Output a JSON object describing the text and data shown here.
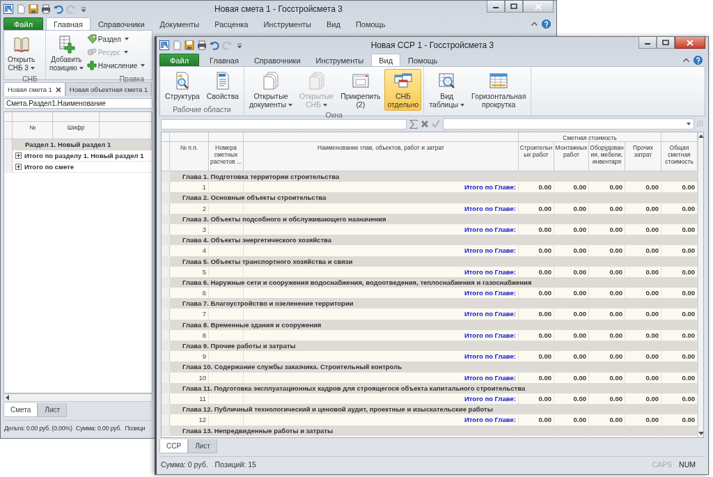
{
  "back_window": {
    "title": "Новая смета 1 - Госстройсмета 3",
    "ribbon_tabs": [
      {
        "label": "Файл",
        "kind": "file",
        "selected": false
      },
      {
        "label": "Главная",
        "kind": "tab",
        "selected": true
      },
      {
        "label": "Справочники",
        "kind": "tab",
        "selected": false
      },
      {
        "label": "Документы",
        "kind": "tab",
        "selected": false
      },
      {
        "label": "Расценка",
        "kind": "tab",
        "selected": false
      },
      {
        "label": "Инструменты",
        "kind": "tab",
        "selected": false
      },
      {
        "label": "Вид",
        "kind": "tab",
        "selected": false
      },
      {
        "label": "Помощь",
        "kind": "tab",
        "selected": false
      }
    ],
    "ribbon_groups": [
      {
        "label": "СНБ",
        "items": [
          {
            "kind": "large",
            "label": "Открыть\nСНБ 3",
            "dropdown": true,
            "disabled": false
          }
        ]
      },
      {
        "label": "Правка",
        "items": [
          {
            "kind": "large",
            "label": "Добавить\nпозицию",
            "dropdown": true,
            "disabled": false
          },
          {
            "kind": "small",
            "label": "Раздел",
            "dropdown": true,
            "disabled": false
          },
          {
            "kind": "small",
            "label": "Ресурс",
            "dropdown": true,
            "disabled": true
          },
          {
            "kind": "small",
            "label": "Начисление",
            "dropdown": true,
            "disabled": false
          }
        ]
      }
    ],
    "document_tabs": [
      {
        "label": "Новая смета 1",
        "selected": true,
        "closable": true
      },
      {
        "label": "Новая объектная смета 1",
        "selected": false,
        "closable": false
      }
    ],
    "formula": "Смета.Раздел1.Наименование",
    "table": {
      "columns": [
        "№",
        "Шифр"
      ],
      "rows": [
        {
          "kind": "section",
          "label": "Раздел 1. Новый раздел 1"
        },
        {
          "kind": "total",
          "label": "Итого по разделу 1. Новый раздел 1",
          "expandable": true
        },
        {
          "kind": "total",
          "label": "Итого по смете",
          "expandable": true
        }
      ]
    },
    "sheet_tabs": [
      {
        "label": "Смета",
        "selected": true
      },
      {
        "label": "Лист",
        "selected": false
      }
    ],
    "status_bar": [
      "Дельта: 0.00 руб. (0.00%)",
      "Сумма: 0.00 руб.",
      "Позици"
    ]
  },
  "front_window": {
    "title": "Новая ССР 1 - Госстройсмета 3",
    "ribbon_tabs": [
      {
        "label": "Файл",
        "kind": "file",
        "selected": false
      },
      {
        "label": "Главная",
        "kind": "tab",
        "selected": false
      },
      {
        "label": "Справочники",
        "kind": "tab",
        "selected": false
      },
      {
        "label": "Инструменты",
        "kind": "tab",
        "selected": false
      },
      {
        "label": "Вид",
        "kind": "tab",
        "selected": true
      },
      {
        "label": "Помощь",
        "kind": "tab",
        "selected": false
      }
    ],
    "ribbon_groups": [
      {
        "label": "Рабочие области",
        "items": [
          {
            "kind": "large",
            "label": "Структура",
            "dropdown": false,
            "disabled": false,
            "selected": false
          },
          {
            "kind": "large",
            "label": "Свойства",
            "dropdown": false,
            "disabled": false,
            "selected": false
          }
        ]
      },
      {
        "label": "Окна",
        "items": [
          {
            "kind": "large",
            "label": "Открытые\nдокументы",
            "dropdown": true,
            "disabled": false,
            "selected": false
          },
          {
            "kind": "large",
            "label": "Открытые\nСНБ",
            "dropdown": true,
            "disabled": true,
            "selected": false
          },
          {
            "kind": "large",
            "label": "Прикрепить\n(2)",
            "dropdown": false,
            "disabled": false,
            "selected": false
          },
          {
            "kind": "large",
            "label": "СНБ\nотдельно",
            "dropdown": false,
            "disabled": false,
            "selected": true
          }
        ]
      },
      {
        "items": [
          {
            "kind": "large",
            "label": "Вид\nтаблицы",
            "dropdown": true,
            "disabled": false,
            "selected": false
          },
          {
            "kind": "large",
            "label": "Горизонтальная\nпрокрутка",
            "dropdown": false,
            "disabled": false,
            "selected": false
          }
        ]
      }
    ],
    "table": {
      "group_header": "Сметная стоимость",
      "columns": [
        "№ п.п.",
        "Номера сметных расчетов ...",
        "Наименование глав, объектов, работ и затрат",
        "Строительных работ",
        "Монтажных работ",
        "Оборудования, мебели, инвентаря",
        "Прочих затрат",
        "Общая сметная стоимость"
      ],
      "chapters": [
        {
          "title": "Глава 1. Подготовка территории строительства",
          "number": "1",
          "total_label": "Итого по Главе:",
          "values": [
            "0.00",
            "0.00",
            "0.00",
            "0.00",
            "0.00"
          ]
        },
        {
          "title": "Глава 2. Основные объекты строительства",
          "number": "2",
          "total_label": "Итого по Главе:",
          "values": [
            "0.00",
            "0.00",
            "0.00",
            "0.00",
            "0.00"
          ]
        },
        {
          "title": "Глава 3. Объекты подсобного и обслуживающего назначения",
          "number": "3",
          "total_label": "Итого по Главе:",
          "values": [
            "0.00",
            "0.00",
            "0.00",
            "0.00",
            "0.00"
          ]
        },
        {
          "title": "Глава 4. Объекты энергетического хозяйства",
          "number": "4",
          "total_label": "Итого по Главе:",
          "values": [
            "0.00",
            "0.00",
            "0.00",
            "0.00",
            "0.00"
          ]
        },
        {
          "title": "Глава 5. Объекты транспортного хозяйства и связи",
          "number": "5",
          "total_label": "Итого по Главе:",
          "values": [
            "0.00",
            "0.00",
            "0.00",
            "0.00",
            "0.00"
          ]
        },
        {
          "title": "Глава 6. Наружные сети и сооружения водоснабжения, водоотведения, теплоснабжения и газоснабжения",
          "number": "6",
          "total_label": "Итого по Главе:",
          "values": [
            "0.00",
            "0.00",
            "0.00",
            "0.00",
            "0.00"
          ]
        },
        {
          "title": "Глава 7. Благоустройство и озеленение территории",
          "number": "7",
          "total_label": "Итого по Главе:",
          "values": [
            "0.00",
            "0.00",
            "0.00",
            "0.00",
            "0.00"
          ]
        },
        {
          "title": "Глава 8. Временные здания и сооружения",
          "number": "8",
          "total_label": "Итого по Главе:",
          "values": [
            "0.00",
            "0.00",
            "0.00",
            "0.00",
            "0.00"
          ]
        },
        {
          "title": "Глава 9. Прочие работы и затраты",
          "number": "9",
          "total_label": "Итого по Главе:",
          "values": [
            "0.00",
            "0.00",
            "0.00",
            "0.00",
            "0.00"
          ]
        },
        {
          "title": "Глава 10. Содержание службы заказчика. Строительный контроль",
          "number": "10",
          "total_label": "Итого по Главе:",
          "values": [
            "0.00",
            "0.00",
            "0.00",
            "0.00",
            "0.00"
          ]
        },
        {
          "title": "Глава 11. Подготовка эксплуатационных кадров для строящегося объекта капитального строительства",
          "number": "11",
          "total_label": "Итого по Главе:",
          "values": [
            "0.00",
            "0.00",
            "0.00",
            "0.00",
            "0.00"
          ]
        },
        {
          "title": "Глава 12. Публичный технологический и ценовой аудит, проектные и изыскательские работы",
          "number": "12",
          "total_label": "Итого по Главе:",
          "values": [
            "0.00",
            "0.00",
            "0.00",
            "0.00",
            "0.00"
          ]
        },
        {
          "title": "Глава 13. Непредвиденные работы и затраты"
        }
      ]
    },
    "sheet_tabs": [
      {
        "label": "ССР",
        "selected": true
      },
      {
        "label": "Лист",
        "selected": false
      }
    ],
    "status_bar": [
      "Сумма: 0 руб.",
      "Позиций: 15"
    ],
    "indicators": [
      {
        "label": "CAPS",
        "on": false
      },
      {
        "label": "NUM",
        "on": true
      }
    ]
  }
}
